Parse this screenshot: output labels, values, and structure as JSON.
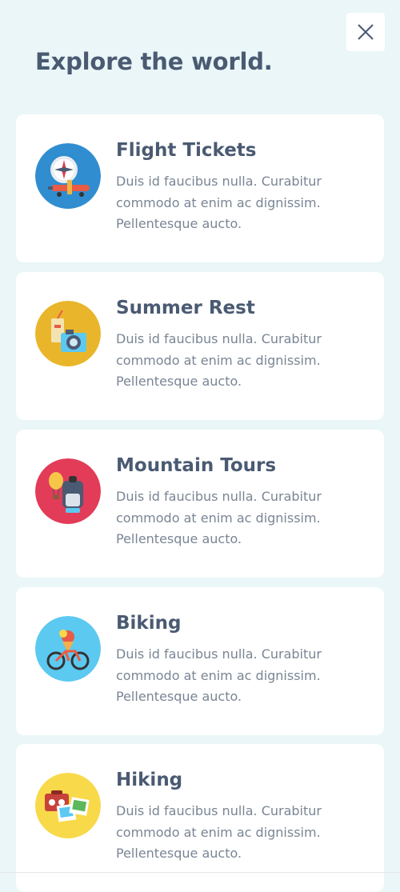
{
  "header": {
    "title": "Explore the world.",
    "close_icon": "close-icon"
  },
  "items": [
    {
      "title": "Flight Tickets",
      "desc": "Duis id faucibus nulla. Curabitur commodo at enim ac dignissim. Pellentesque aucto.",
      "icon": "compass-plane-icon",
      "color": "#2f8dd0"
    },
    {
      "title": "Summer Rest",
      "desc": "Duis id faucibus nulla. Curabitur commodo at enim ac dignissim. Pellentesque aucto.",
      "icon": "camera-drink-icon",
      "color": "#e9b62b"
    },
    {
      "title": "Mountain Tours",
      "desc": "Duis id faucibus nulla. Curabitur commodo at enim ac dignissim. Pellentesque aucto.",
      "icon": "backpack-balloon-icon",
      "color": "#e23c58"
    },
    {
      "title": "Biking",
      "desc": "Duis id faucibus nulla. Curabitur commodo at enim ac dignissim. Pellentesque aucto.",
      "icon": "bicycle-icon",
      "color": "#5cc9f1"
    },
    {
      "title": "Hiking",
      "desc": "Duis id faucibus nulla. Curabitur commodo at enim ac dignissim. Pellentesque aucto.",
      "icon": "suitcase-photos-icon",
      "color": "#f8d94a"
    }
  ]
}
